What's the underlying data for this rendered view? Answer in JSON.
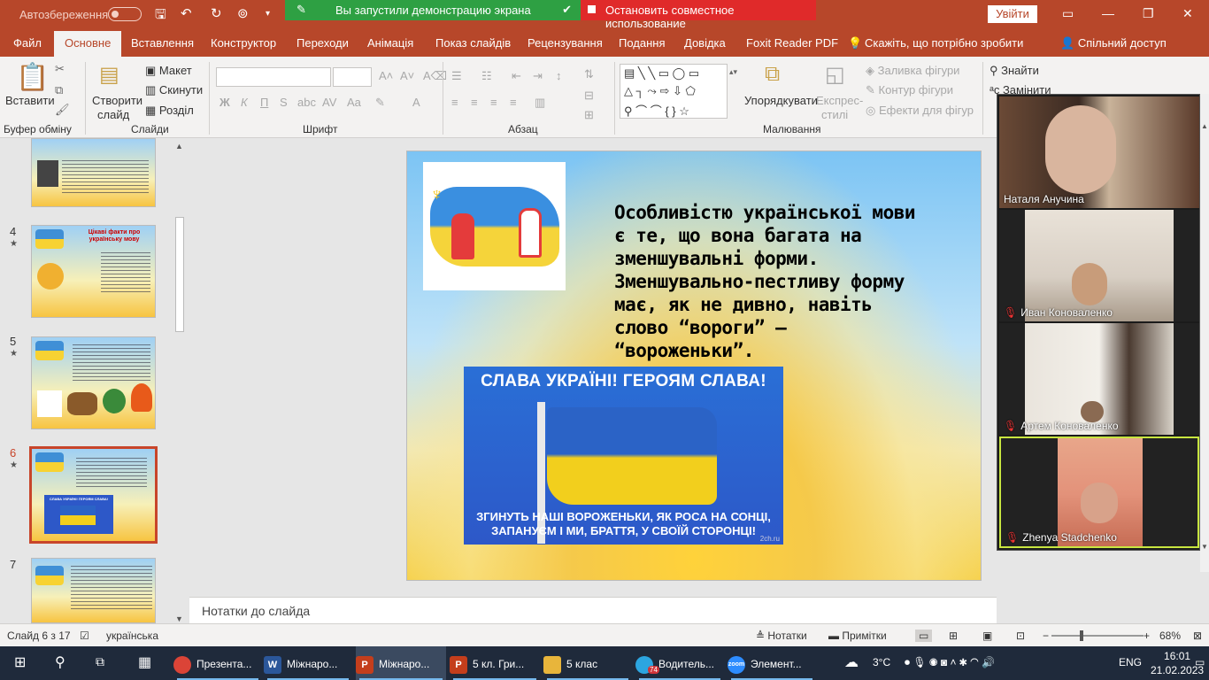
{
  "titlebar": {
    "autosave_label": "Автозбереження",
    "share_status": "Вы запустили демонстрацию экрана",
    "stop_share": "Остановить совместное использование",
    "signin": "Увійти"
  },
  "tabs": [
    "Файл",
    "Основне",
    "Вставлення",
    "Конструктор",
    "Переходи",
    "Анімація",
    "Показ слайдів",
    "Рецензування",
    "Подання",
    "Довідка",
    "Foxit Reader PDF",
    "Скажіть, що потрібно зробити"
  ],
  "share_tab": "Спільний доступ",
  "ribbon": {
    "paste": "Вставити",
    "clipboard_group": "Буфер обміну",
    "new_slide_l1": "Створити",
    "new_slide_l2": "слайд",
    "layout": "Макет",
    "reset": "Скинути",
    "section": "Розділ",
    "slides_group": "Слайди",
    "font_group": "Шрифт",
    "paragraph_group": "Абзац",
    "arrange": "Упорядкувати",
    "quick_styles_l1": "Експрес-",
    "quick_styles_l2": "стилі",
    "shape_fill": "Заливка фігури",
    "shape_outline": "Контур фігури",
    "shape_effects": "Ефекти для фігур",
    "drawing_group": "Малювання",
    "find": "Знайти",
    "replace": "Замінити"
  },
  "thumbnails": [
    {
      "num": "",
      "star": ""
    },
    {
      "num": "4",
      "star": "★",
      "title": "Цікаві факти про українську мову"
    },
    {
      "num": "5",
      "star": "★"
    },
    {
      "num": "6",
      "star": "★",
      "poster": "СЛАВА УКРАЇНІ! ГЕРОЯМ СЛАВА!"
    },
    {
      "num": "7",
      "star": ""
    }
  ],
  "slide": {
    "text": "Особливістю української мови є те, що вона багата на зменшувальні форми. Зменшувально-пестливу форму має, як не дивно, навіть слово “вороги” – “вороженьки”.",
    "poster_top": "СЛАВА УКРАЇНІ! ГЕРОЯМ СЛАВА!",
    "poster_bottom_l1": "ЗГИНУТЬ НАШІ ВОРОЖЕНЬКИ, ЯК РОСА НА СОНЦІ,",
    "poster_bottom_l2": "ЗАПАНУЄМ І МИ, БРАТТЯ, У СВОЇЙ СТОРОНЦІ!",
    "poster_credit": "2ch.ru"
  },
  "notes_placeholder": "Нотатки до слайда",
  "participants": [
    {
      "name": "Наталя Анучина",
      "muted": false
    },
    {
      "name": "Иван Коноваленко",
      "muted": true
    },
    {
      "name": "Артем Коноваленко",
      "muted": true
    },
    {
      "name": "Zhenya Stadchenko",
      "muted": true
    }
  ],
  "status": {
    "slide_info": "Слайд 6 з 17",
    "language": "українська",
    "notes": "Нотатки",
    "comments": "Примітки",
    "zoom": "68%"
  },
  "taskbar": {
    "apps": [
      {
        "label": "Презента...",
        "icon": "chrome-icon",
        "color": "#db4437"
      },
      {
        "label": "Міжнаро...",
        "icon": "word-icon",
        "color": "#2b579a"
      },
      {
        "label": "Міжнаро...",
        "icon": "powerpoint-icon",
        "color": "#c43e1c"
      },
      {
        "label": "5 кл. Гри...",
        "icon": "powerpoint-icon",
        "color": "#c43e1c"
      },
      {
        "label": "5 клас",
        "icon": "folder-icon",
        "color": "#e8b53b"
      },
      {
        "label": "Водитель...",
        "icon": "telegram-icon",
        "color": "#2ca5e0"
      },
      {
        "label": "Элемент...",
        "icon": "zoom-icon",
        "color": "#2d8cff"
      }
    ],
    "telegram_badge": "74",
    "weather": "3°C",
    "lang": "ENG",
    "time": "16:01",
    "date": "21.02.2023"
  }
}
